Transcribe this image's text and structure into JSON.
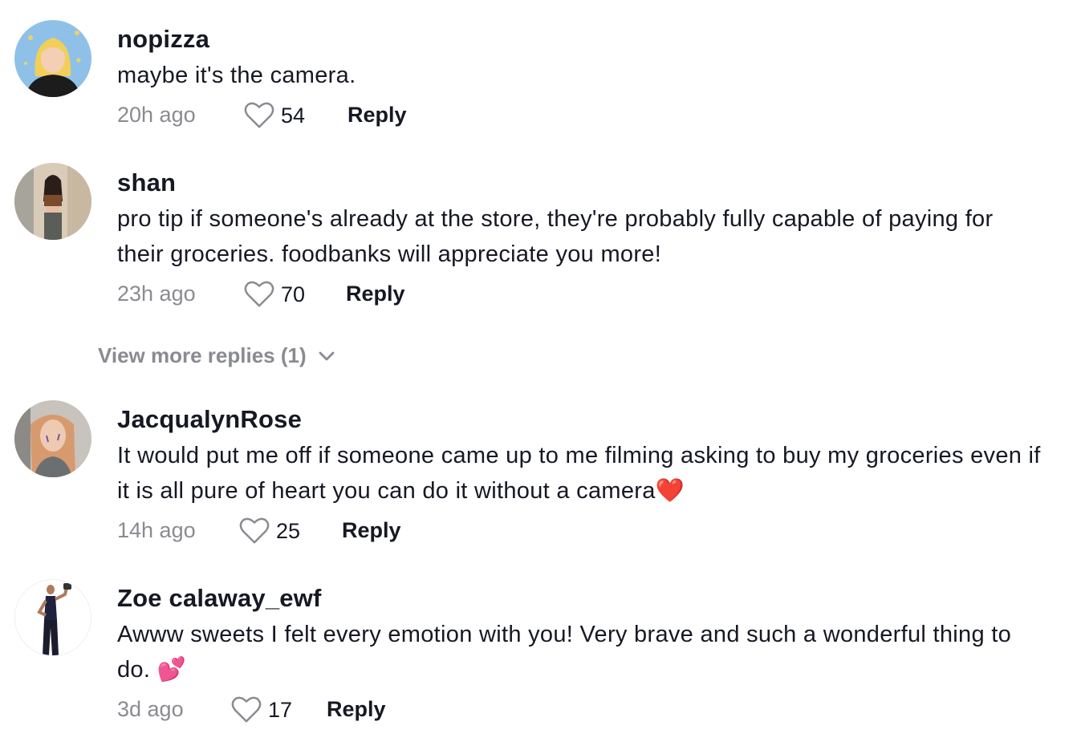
{
  "comments": [
    {
      "username": "nopizza",
      "text": "maybe it's the camera.",
      "time": "20h ago",
      "likes": "54",
      "reply_label": "Reply",
      "avatar": "cartoon-blonde-girl-avatar"
    },
    {
      "username": "shan",
      "text": "pro tip if someone's already at the store, they're probably fully capable of paying for their groceries. foodbanks will appreciate you more!",
      "time": "23h ago",
      "likes": "70",
      "reply_label": "Reply",
      "avatar": "mirror-selfie-avatar",
      "view_more_replies": "View more replies (1)"
    },
    {
      "username": "JacqualynRose",
      "text": "It would put me off if someone came up to me filming asking to buy my groceries even if it is all pure of heart you can do it without a camera❤️",
      "time": "14h ago",
      "likes": "25",
      "reply_label": "Reply",
      "avatar": "redhead-selfie-avatar"
    },
    {
      "username": "Zoe calaway_ewf",
      "text": "Awww sweets I felt every emotion with you! Very brave and such a wonderful thing to do. 💕",
      "time": "3d ago",
      "likes": "17",
      "reply_label": "Reply",
      "avatar": "fitness-woman-avatar"
    }
  ],
  "colors": {
    "text_primary": "#161823",
    "text_secondary": "#8a8b91",
    "background": "#ffffff"
  }
}
